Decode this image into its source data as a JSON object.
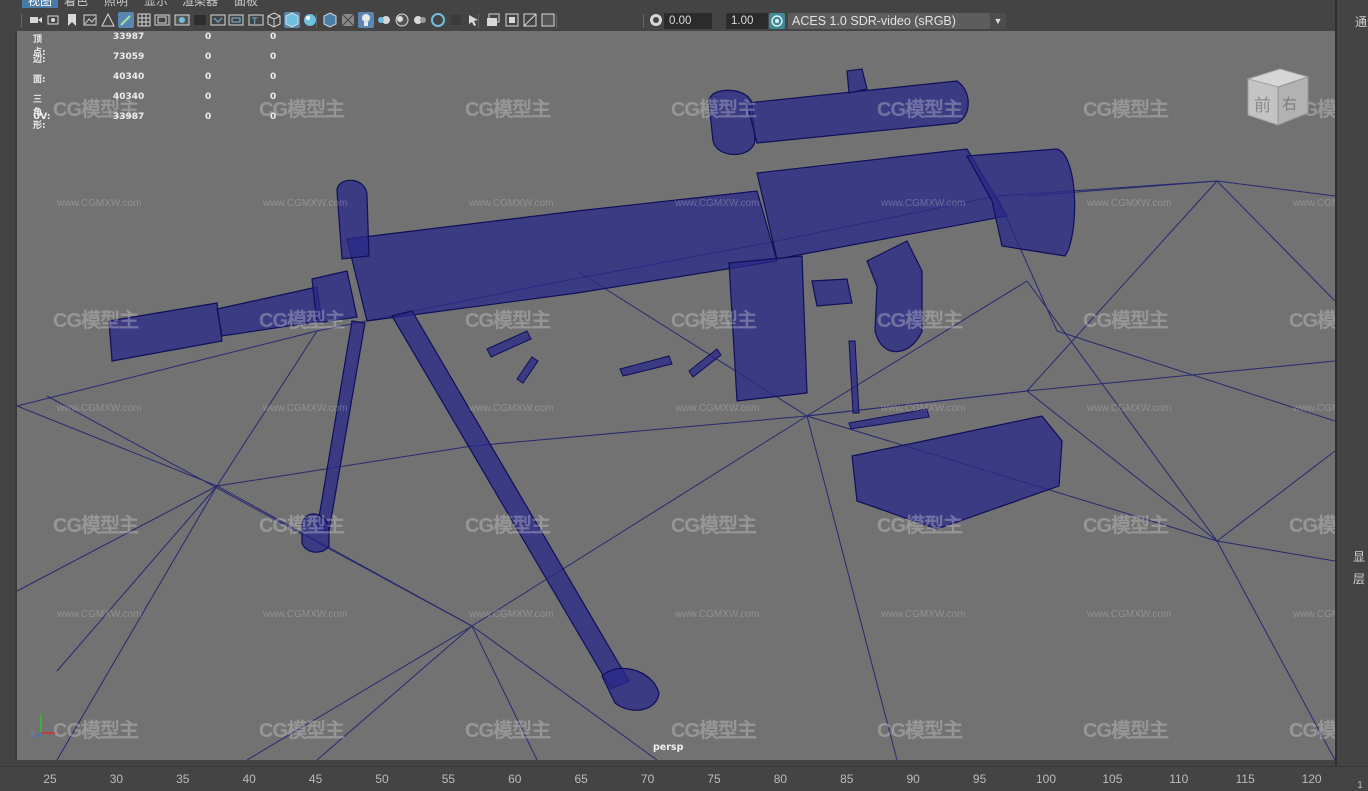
{
  "menubar": {
    "items": [
      "视图",
      "着色",
      "照明",
      "显示",
      "渲染器",
      "面板"
    ],
    "active_index": 0
  },
  "toolbar": {
    "exposure_value": "0.00",
    "gamma_value": "1.00",
    "color_space": "ACES 1.0 SDR-video (sRGB)",
    "icons": [
      "camera-select-icon",
      "camera-attributes-icon",
      "bookmark-icon",
      "image-plane-icon",
      "grid-2d-icon",
      "grease-pencil-icon",
      "grid-icon",
      "film-gate-icon",
      "resolution-gate-icon",
      "gate-mask-icon",
      "field-chart-icon",
      "safe-action-icon",
      "safe-title-icon",
      "wireframe-icon",
      "smooth-shade-icon",
      "use-default-material-icon",
      "wireframe-on-shaded-icon",
      "xray-icon",
      "use-all-lights-icon",
      "shadows-icon",
      "screen-space-ao-icon",
      "motion-blur-icon",
      "anti-aliasing-icon",
      "depth-of-field-icon",
      "isolate-select-icon",
      "xray-joints-icon",
      "xray-active-icon",
      "backface-culling-icon",
      "exposure-icon",
      "gamma-icon",
      "color-management-icon"
    ]
  },
  "hud": {
    "rows": [
      {
        "label": "顶点:",
        "v1": "33987",
        "v2": "0",
        "v3": "0"
      },
      {
        "label": "边:",
        "v1": "73059",
        "v2": "0",
        "v3": "0"
      },
      {
        "label": "面:",
        "v1": "40340",
        "v2": "0",
        "v3": "0"
      },
      {
        "label": "三角形:",
        "v1": "40340",
        "v2": "0",
        "v3": "0"
      },
      {
        "label": "UV:",
        "v1": "33987",
        "v2": "0",
        "v3": "0"
      }
    ]
  },
  "viewport": {
    "camera_label": "persp",
    "background_color": "#727272",
    "wire_color": "#1a1a7a",
    "scene_object": "sniper-rifle-wireframe-model"
  },
  "viewcube": {
    "front_label": "前",
    "right_label": "右"
  },
  "axis_indicator": {
    "x": "x",
    "y": "y",
    "z": "z"
  },
  "watermark": {
    "logo_text": "CG模型主",
    "url_text": "www.CGMXW.com"
  },
  "right_panel": {
    "top_label": "通道",
    "label_display": "显",
    "label_layer": "层"
  },
  "timeline": {
    "ticks": [
      "25",
      "30",
      "35",
      "40",
      "45",
      "50",
      "55",
      "60",
      "65",
      "70",
      "75",
      "80",
      "85",
      "90",
      "95",
      "100",
      "105",
      "110",
      "115",
      "120"
    ],
    "current_frame": "1"
  }
}
